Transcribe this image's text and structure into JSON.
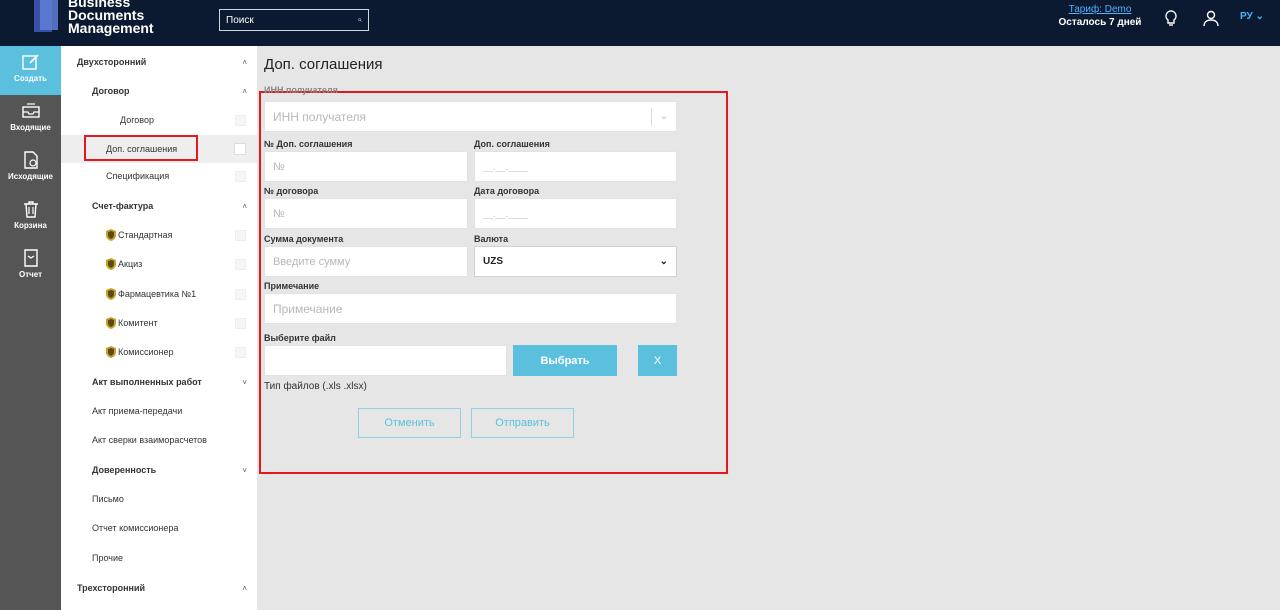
{
  "header": {
    "logo_line1": "Business",
    "logo_line2": "Documents",
    "logo_line3": "Management",
    "search_placeholder": "Поиск",
    "tariff_link": "Тариф: Demo",
    "days_left": "Осталось 7 дней",
    "lang": "РУ"
  },
  "rail": [
    {
      "label": "Создать",
      "icon": "create-icon"
    },
    {
      "label": "Входящие",
      "icon": "inbox-icon"
    },
    {
      "label": "Исходящие",
      "icon": "outgoing-icon"
    },
    {
      "label": "Корзина",
      "icon": "trash-icon"
    },
    {
      "label": "Отчет",
      "icon": "report-icon"
    }
  ],
  "tree": {
    "bilateral": "Двухсторонний",
    "contract_group": "Договор",
    "contract": "Договор",
    "addendum": "Доп. соглашения",
    "specification": "Спецификация",
    "invoice_group": "Счет-фактура",
    "standard": "Стандартная",
    "excise": "Акциз",
    "pharma": "Фармацевтика №1",
    "committent": "Комитент",
    "commissioner": "Комиссионер",
    "acts_group": "Акт выполненных работ",
    "acceptance": "Акт приема-передачи",
    "reconciliation": "Акт сверки взаиморасчетов",
    "poa_group": "Доверенность",
    "letter": "Письмо",
    "commissioner_report": "Отчет комиссионера",
    "other": "Прочие",
    "trilateral": "Трехсторонний"
  },
  "main": {
    "title": "Доп. соглашения",
    "inn_label": "ИНН получателя",
    "inn_placeholder": "ИНН получателя",
    "addendum_no_label": "№ Доп. соглашения",
    "addendum_no_placeholder": "№",
    "addendum_date_label": "Доп. соглашения",
    "addendum_date_placeholder": "__.__.____",
    "contract_no_label": "№ договора",
    "contract_no_placeholder": "№",
    "contract_date_label": "Дата договора",
    "contract_date_placeholder": "__.__.____",
    "amount_label": "Сумма документа",
    "amount_placeholder": "Введите сумму",
    "currency_label": "Валюта",
    "currency_value": "UZS",
    "note_label": "Примечание",
    "note_placeholder": "Примечание",
    "file_label": "Выберите файл",
    "choose_button": "Выбрать",
    "clear_button": "X",
    "file_types": "Тип файлов (.xls .xlsx)",
    "cancel_button": "Отменить",
    "submit_button": "Отправить"
  },
  "colors": {
    "topbar": "#0b1a30",
    "accent": "#5bc0de",
    "highlight": "#e3191e",
    "rail": "#555555"
  }
}
